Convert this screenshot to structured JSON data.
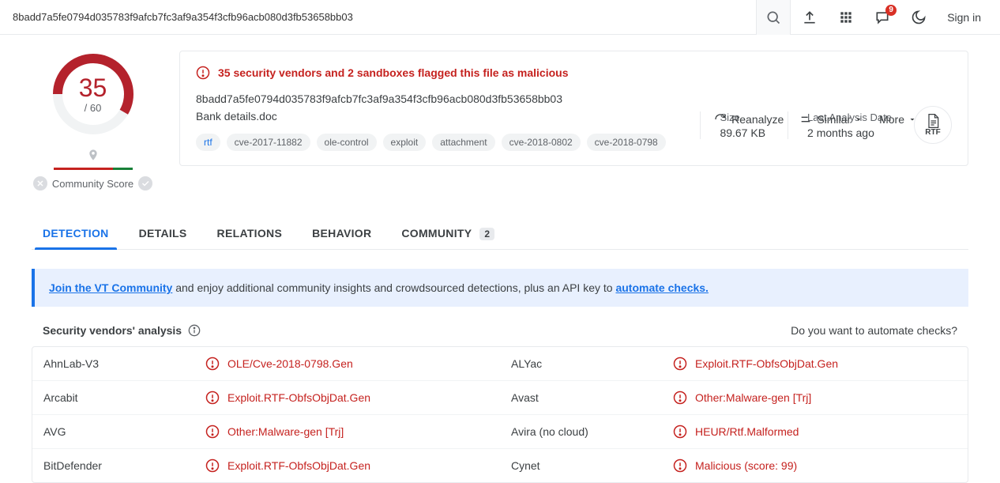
{
  "topbar": {
    "hash": "8badd7a5fe0794d035783f9afcb7fc3af9a354f3cfb96acb080d3fb53658bb03",
    "notif_count": "9",
    "signin": "Sign in"
  },
  "score": {
    "numerator": "35",
    "denominator": "/ 60",
    "community_label": "Community Score"
  },
  "overview": {
    "flag_text": "35 security vendors and 2 sandboxes flagged this file as malicious",
    "hash": "8badd7a5fe0794d035783f9afcb7fc3af9a354f3cfb96acb080d3fb53658bb03",
    "filename": "Bank details.doc",
    "tags": [
      "rtf",
      "cve-2017-11882",
      "ole-control",
      "exploit",
      "attachment",
      "cve-2018-0802",
      "cve-2018-0798"
    ],
    "actions": {
      "reanalyze": "Reanalyze",
      "similar": "Similar",
      "more": "More"
    },
    "size_lbl": "Size",
    "size_val": "89.67 KB",
    "date_lbl": "Last Analysis Date",
    "date_val": "2 months ago",
    "filetype": "RTF"
  },
  "tabs": {
    "detection": "DETECTION",
    "details": "DETAILS",
    "relations": "RELATIONS",
    "behavior": "BEHAVIOR",
    "community": "COMMUNITY",
    "community_count": "2"
  },
  "banner": {
    "link1": "Join the VT Community",
    "mid": " and enjoy additional community insights and crowdsourced detections, plus an API key to ",
    "link2": "automate checks."
  },
  "section": {
    "title": "Security vendors' analysis",
    "right": "Do you want to automate checks?"
  },
  "vendors": [
    {
      "a_name": "AhnLab-V3",
      "a_det": "OLE/Cve-2018-0798.Gen",
      "b_name": "ALYac",
      "b_det": "Exploit.RTF-ObfsObjDat.Gen"
    },
    {
      "a_name": "Arcabit",
      "a_det": "Exploit.RTF-ObfsObjDat.Gen",
      "b_name": "Avast",
      "b_det": "Other:Malware-gen [Trj]"
    },
    {
      "a_name": "AVG",
      "a_det": "Other:Malware-gen [Trj]",
      "b_name": "Avira (no cloud)",
      "b_det": "HEUR/Rtf.Malformed"
    },
    {
      "a_name": "BitDefender",
      "a_det": "Exploit.RTF-ObfsObjDat.Gen",
      "b_name": "Cynet",
      "b_det": "Malicious (score: 99)"
    }
  ]
}
